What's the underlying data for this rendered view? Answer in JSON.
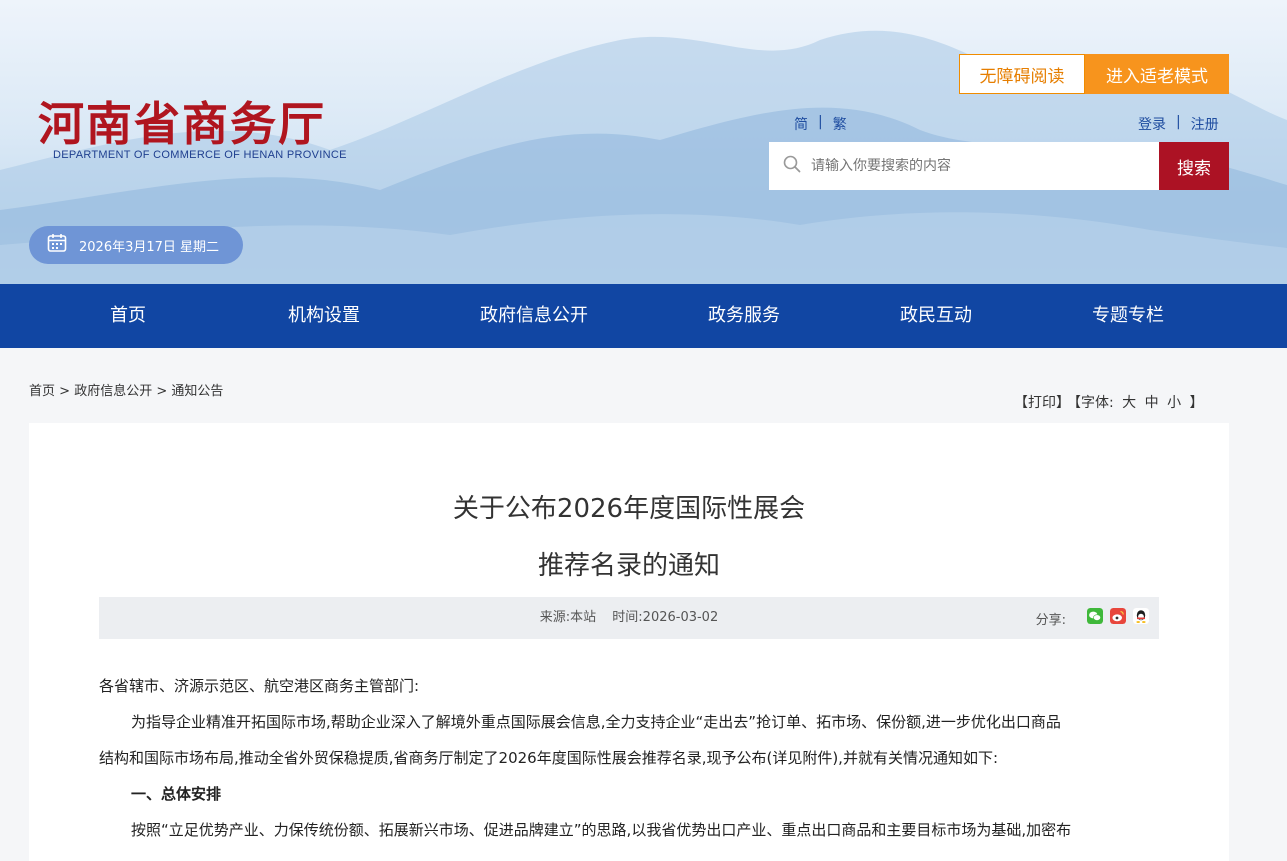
{
  "header": {
    "logo_cn": "河南省商务厅",
    "logo_en": "DEPARTMENT OF COMMERCE OF HENAN PROVINCE",
    "accessibility_label": "无障碍阅读",
    "elder_mode_label": "进入适老模式",
    "lang_simplified": "简",
    "lang_separator": "|",
    "lang_traditional": "繁",
    "login_label": "登录",
    "account_separator": "|",
    "register_label": "注册",
    "search_placeholder": "请输入你要搜索的内容",
    "search_button": "搜索",
    "date": "2026年3月17日 星期二"
  },
  "nav": {
    "items": [
      "首页",
      "机构设置",
      "政府信息公开",
      "政务服务",
      "政民互动",
      "专题专栏"
    ]
  },
  "breadcrumb": {
    "home": "首页",
    "sep1": ">",
    "section": "政府信息公开",
    "sep2": ">",
    "current": "通知公告"
  },
  "tools": {
    "print": "【打印】",
    "font_open": "【字体:",
    "font_large": "大",
    "font_medium": "中",
    "font_small": "小",
    "font_close": "】"
  },
  "article": {
    "title_line1": "关于公布2026年度国际性展会",
    "title_line2": "推荐名录的通知",
    "source": "来源:本站",
    "time": "时间:2026-03-02",
    "share_label": "分享:",
    "share_icons": [
      "wechat-icon",
      "weibo-icon",
      "qq-icon"
    ],
    "salutation": "各省辖市、济源示范区、航空港区商务主管部门:",
    "para1_line1": "为指导企业精准开拓国际市场,帮助企业深入了解境外重点国际展会信息,全力支持企业“走出去”抢订单、拓市场、保份额,进一步优化出口商品",
    "para1_line2": "结构和国际市场布局,推动全省外贸保稳提质,省商务厅制定了2026年度国际性展会推荐名录,现予公布(详见附件),并就有关情况通知如下:",
    "section1_heading": "一、总体安排",
    "para2_line1": "按照“立足优势产业、力保传统份额、拓展新兴市场、促进品牌建立”的思路,以我省优势出口产业、重点出口商品和主要目标市场为基础,加密布"
  },
  "colors": {
    "brand_red": "#b0151f",
    "nav_blue": "#1146a3",
    "accent_orange": "#f7941d",
    "search_red": "#ac1224",
    "date_pill": "#6f95d6"
  }
}
